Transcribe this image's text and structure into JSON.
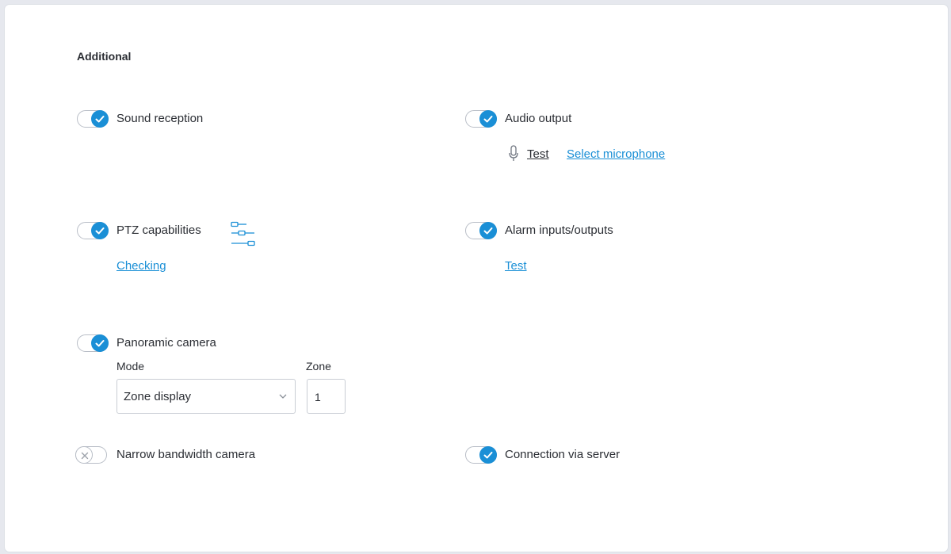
{
  "section": {
    "title": "Additional"
  },
  "sound_reception": {
    "label": "Sound reception",
    "enabled": true
  },
  "audio_output": {
    "label": "Audio output",
    "enabled": true,
    "test_label": "Test",
    "select_mic_label": "Select microphone"
  },
  "ptz": {
    "label": "PTZ capabilities",
    "enabled": true,
    "checking_label": "Checking"
  },
  "alarm": {
    "label": "Alarm inputs/outputs",
    "enabled": true,
    "test_label": "Test"
  },
  "panoramic": {
    "label": "Panoramic camera",
    "enabled": true,
    "mode_label": "Mode",
    "mode_value": "Zone display",
    "zone_label": "Zone",
    "zone_value": "1"
  },
  "narrow_bandwidth": {
    "label": "Narrow bandwidth camera",
    "enabled": false
  },
  "connection_via_server": {
    "label": "Connection via server",
    "enabled": true
  },
  "colors": {
    "accent": "#1a8fd6",
    "text": "#2a2d33",
    "border": "#c9cdd4"
  },
  "icons": [
    "check-icon",
    "microphone-icon",
    "sliders-icon",
    "chevron-down-icon",
    "x-icon"
  ]
}
